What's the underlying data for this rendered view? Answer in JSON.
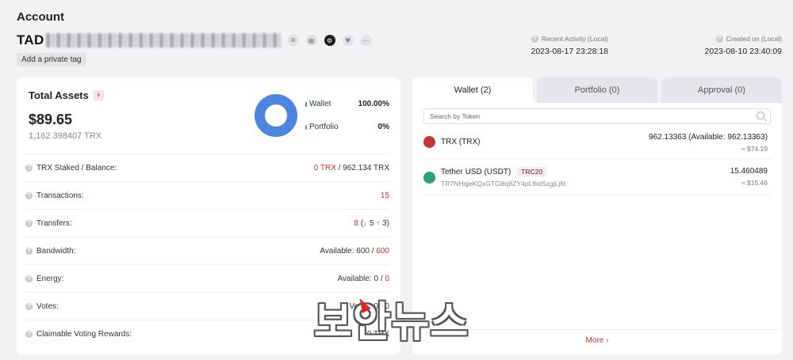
{
  "page": {
    "title": "Account"
  },
  "address": {
    "prefix": "TAD",
    "icons": [
      "copy-icon",
      "qr-code-icon",
      "settings-icon",
      "heart-icon",
      "more-icon"
    ]
  },
  "private_tag_button": "Add a private tag",
  "recent_activity": {
    "label": "Recent Activity (Local)",
    "value": "2023-08-17 23:28:18"
  },
  "created_on": {
    "label": "Created on (Local)",
    "value": "2023-08-10 23:40:09"
  },
  "total_assets": {
    "title": "Total Assets",
    "usd": "$89.65",
    "trx": "1,162.398407 TRX",
    "legend": [
      {
        "name": "Wallet",
        "pct": "100.00%",
        "color": "#4d86e0"
      },
      {
        "name": "Portfolio",
        "pct": "0%",
        "color": "#e06a6a"
      }
    ]
  },
  "stats": {
    "staked": {
      "label": "TRX Staked / Balance:",
      "staked": "0 TRX",
      "sep": "/",
      "balance": "962.134 TRX"
    },
    "transactions": {
      "label": "Transactions:",
      "value": "15"
    },
    "transfers": {
      "label": "Transfers:",
      "total": "8",
      "open": "(",
      "in": "5",
      "out": "3",
      "close": ")"
    },
    "bandwidth": {
      "label": "Bandwidth:",
      "prefix": "Available:",
      "available": "600",
      "sep": "/",
      "total": "600"
    },
    "energy": {
      "label": "Energy:",
      "prefix": "Available:",
      "available": "0",
      "sep": "/",
      "total": "0"
    },
    "votes": {
      "label": "Votes:",
      "value": "Voted: 0 / 0"
    },
    "claimable": {
      "label": "Claimable Voting Rewards:",
      "value": "0 TRX"
    }
  },
  "tabs": [
    {
      "label": "Wallet (2)",
      "active": true
    },
    {
      "label": "Portfolio (0)",
      "active": false
    },
    {
      "label": "Approval (0)",
      "active": false
    }
  ],
  "search": {
    "placeholder": "Search by Token"
  },
  "tokens": [
    {
      "name": "TRX (TRX)",
      "amount": "962.13363 (Available: 962.13363)",
      "usd": "≈ $74.19",
      "icon_color": "#c23631"
    },
    {
      "name": "Tether USD (USDT)",
      "badge": "TRC20",
      "contract": "TR7NHqjeKQxGTCi8q8ZY4pL8otSzgjLj6t",
      "amount": "15.460489",
      "usd": "≈ $15.46",
      "icon_color": "#26a17b"
    }
  ],
  "more_label": "More ›",
  "watermark": "보안뉴스"
}
